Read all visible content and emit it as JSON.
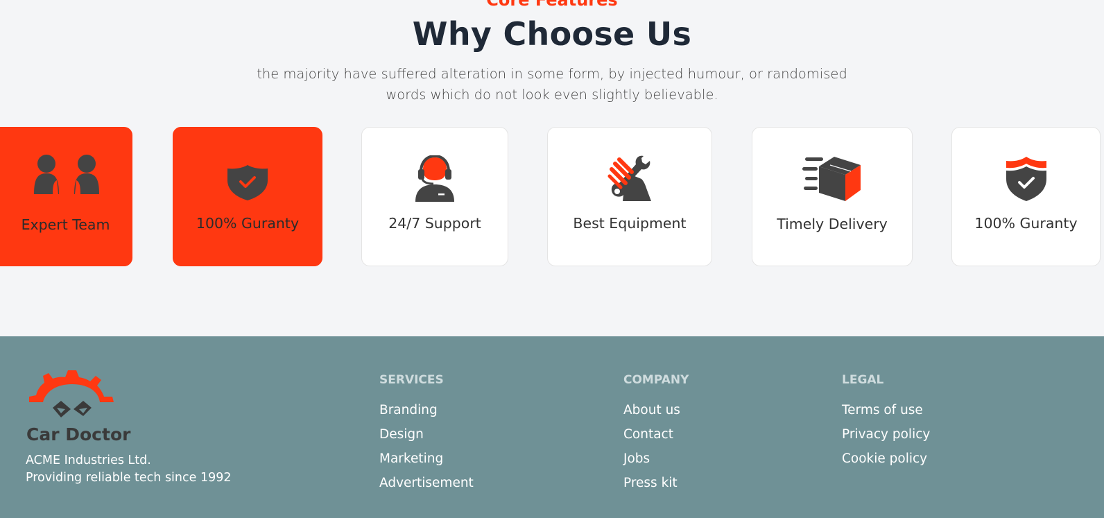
{
  "section": {
    "eyebrow": "Core Features",
    "title": "Why Choose Us",
    "subtitle": "the majority have suffered alteration in some form, by injected humour, or randomised words which do not look even slightly believable."
  },
  "features": [
    {
      "label": "Expert Team",
      "icon": "team-icon",
      "active": true
    },
    {
      "label": "100% Guranty",
      "icon": "shield-check-icon",
      "active": true
    },
    {
      "label": "24/7 Support",
      "icon": "support-agent-icon",
      "active": false
    },
    {
      "label": "Best Equipment",
      "icon": "wrench-hand-icon",
      "active": false
    },
    {
      "label": "Timely Delivery",
      "icon": "delivery-box-icon",
      "active": false
    },
    {
      "label": "100% Guranty",
      "icon": "shield-check-icon",
      "active": false
    }
  ],
  "footer": {
    "brand": {
      "name": "Car Doctor",
      "line1": "ACME Industries Ltd.",
      "line2": "Providing reliable tech since 1992",
      "logo_icon": "gear-logo-icon"
    },
    "columns": [
      {
        "title": "SERVICES",
        "links": [
          "Branding",
          "Design",
          "Marketing",
          "Advertisement"
        ]
      },
      {
        "title": "COMPANY",
        "links": [
          "About us",
          "Contact",
          "Jobs",
          "Press kit"
        ]
      },
      {
        "title": "LEGAL",
        "links": [
          "Terms of use",
          "Privacy policy",
          "Cookie policy"
        ]
      }
    ]
  },
  "colors": {
    "accent": "#ff3811",
    "icon_dark": "#444444",
    "footer_bg": "#6f9196",
    "page_bg": "#f4f5f7"
  }
}
